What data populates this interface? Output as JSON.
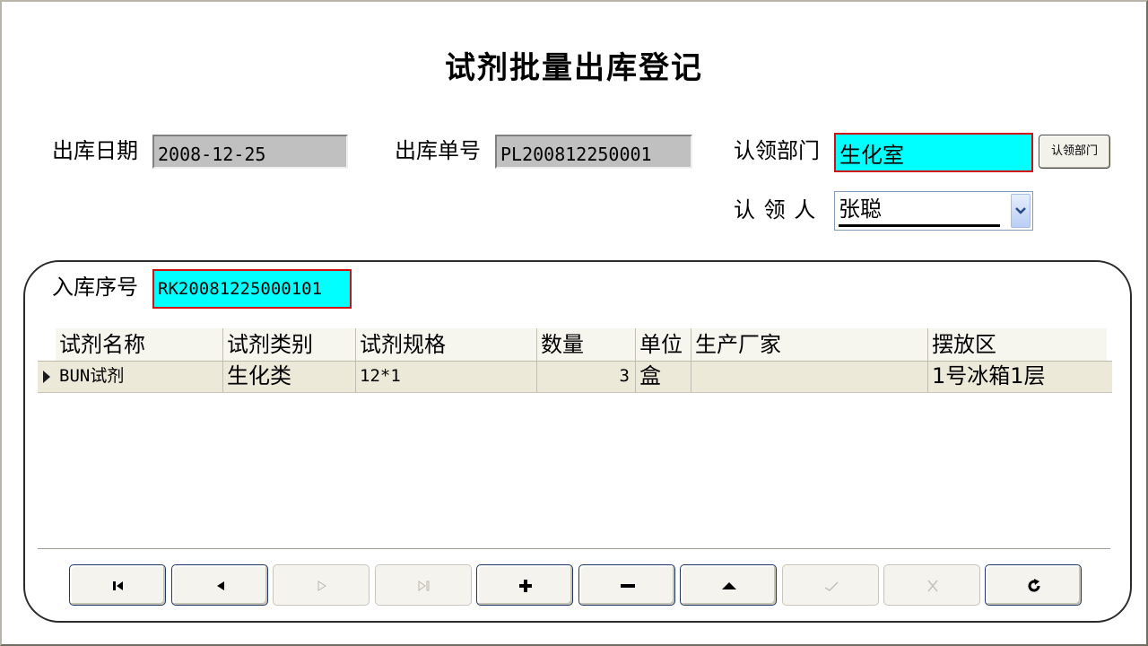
{
  "title": "试剂批量出库登记",
  "form": {
    "out_date_label": "出库日期",
    "out_date_value": "2008-12-25",
    "out_no_label": "出库单号",
    "out_no_value": "PL200812250001",
    "dept_label": "认领部门",
    "dept_value": "生化室",
    "dept_button": "认领部门",
    "person_label": "认 领 人",
    "person_value": "张聪"
  },
  "panel": {
    "in_no_label": "入库序号",
    "in_no_value": "RK20081225000101"
  },
  "grid": {
    "columns": [
      "试剂名称",
      "试剂类别",
      "试剂规格",
      "数量",
      "单位",
      "生产厂家",
      "摆放区"
    ],
    "rows": [
      {
        "name": "BUN试剂",
        "category": "生化类",
        "spec": "12*1",
        "qty": "3",
        "unit": "盒",
        "maker": "",
        "location": "1号冰箱1层"
      }
    ]
  },
  "nav_buttons": [
    {
      "icon": "first-record-icon",
      "enabled": true
    },
    {
      "icon": "prev-record-icon",
      "enabled": true
    },
    {
      "icon": "next-record-icon",
      "enabled": false
    },
    {
      "icon": "last-record-icon",
      "enabled": false
    },
    {
      "icon": "add-icon",
      "enabled": true
    },
    {
      "icon": "delete-icon",
      "enabled": true
    },
    {
      "icon": "edit-icon",
      "enabled": true
    },
    {
      "icon": "save-icon",
      "enabled": false
    },
    {
      "icon": "cancel-icon",
      "enabled": false
    },
    {
      "icon": "refresh-icon",
      "enabled": true
    }
  ]
}
